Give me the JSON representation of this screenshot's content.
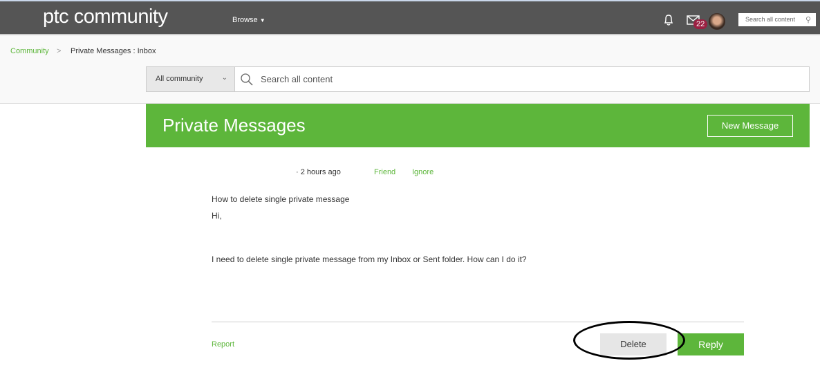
{
  "header": {
    "logo": "ptc community",
    "logo_mark": "®",
    "browse": "Browse",
    "message_count": "22",
    "search_placeholder": "Search all content"
  },
  "breadcrumb": {
    "root": "Community",
    "sep": ">",
    "current": "Private Messages : Inbox"
  },
  "search": {
    "scope": "All community",
    "placeholder": "Search all content"
  },
  "banner": {
    "title": "Private Messages",
    "new_message": "New Message"
  },
  "message": {
    "time": "2 hours ago",
    "friend": "Friend",
    "ignore": "Ignore",
    "subject": "How to delete single private message",
    "greeting": "Hi,",
    "body": "I need to delete single private message from my Inbox or Sent folder. How can I do it?"
  },
  "actions": {
    "report": "Report",
    "delete": "Delete",
    "reply": "Reply"
  },
  "colors": {
    "accent": "#5db63b",
    "header": "#555555",
    "badge": "#9b2042"
  }
}
